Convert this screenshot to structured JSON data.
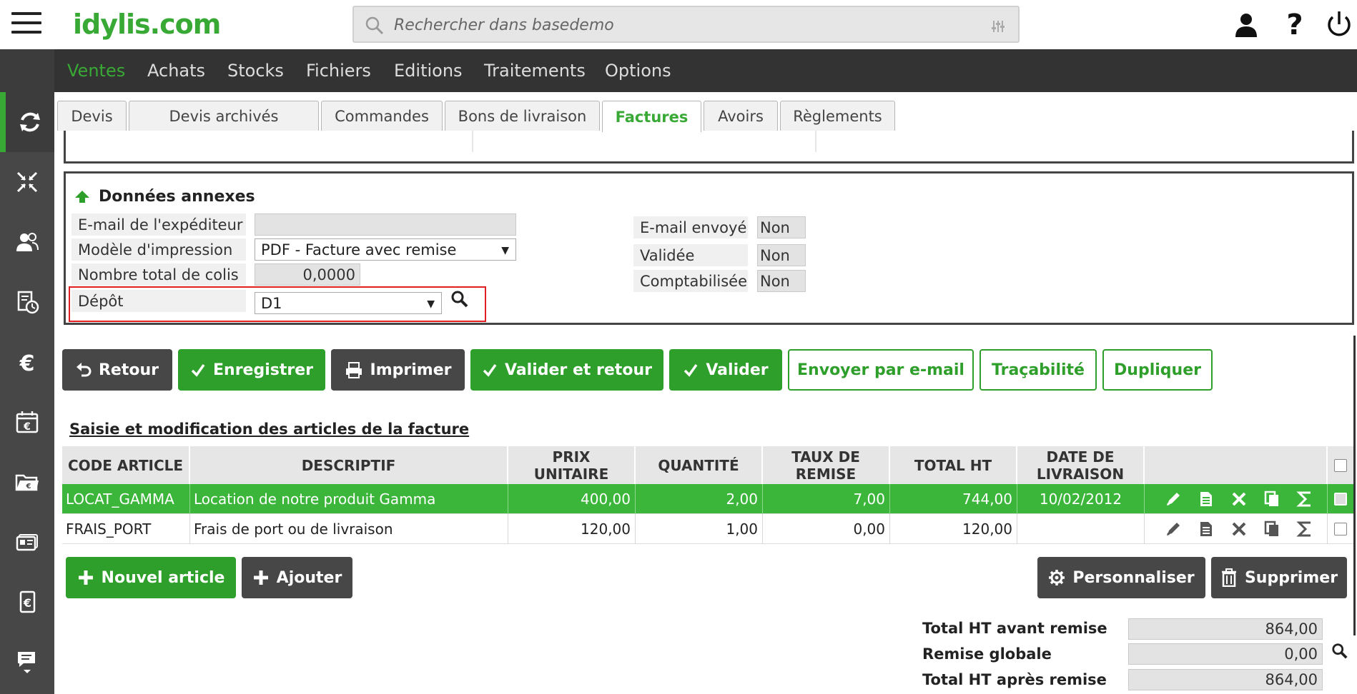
{
  "app": {
    "logo": "idylis.com"
  },
  "search": {
    "placeholder": "Rechercher dans basedemo"
  },
  "menu": [
    "Ventes",
    "Achats",
    "Stocks",
    "Fichiers",
    "Editions",
    "Traitements",
    "Options"
  ],
  "tabs": [
    "Devis",
    "Devis archivés",
    "Commandes",
    "Bons de livraison",
    "Factures",
    "Avoirs",
    "Règlements"
  ],
  "annex": {
    "title": "Données annexes",
    "email_expediteur_label": "E-mail de l'expéditeur",
    "email_expediteur_value": "",
    "modele_label": "Modèle d'impression",
    "modele_value": "PDF - Facture avec remise",
    "colis_label": "Nombre total de colis",
    "colis_value": "0,0000",
    "depot_label": "Dépôt",
    "depot_value": "D1",
    "email_envoye_label": "E-mail envoyé",
    "email_envoye_value": "Non",
    "validee_label": "Validée",
    "validee_value": "Non",
    "comptabilisee_label": "Comptabilisée",
    "comptabilisee_value": "Non"
  },
  "actions": {
    "retour": "Retour",
    "enregistrer": "Enregistrer",
    "imprimer": "Imprimer",
    "valider_retour": "Valider et retour",
    "valider": "Valider",
    "envoyer": "Envoyer par e-mail",
    "tracabilite": "Traçabilité",
    "dupliquer": "Dupliquer"
  },
  "section_title": "Saisie et modification des articles de la facture",
  "table": {
    "headers": {
      "code": "CODE ARTICLE",
      "descriptif": "DESCRIPTIF",
      "prix_1": "PRIX",
      "prix_2": "UNITAIRE",
      "quantite": "QUANTITÉ",
      "remise_1": "TAUX DE",
      "remise_2": "REMISE",
      "total": "TOTAL HT",
      "date_1": "DATE DE",
      "date_2": "LIVRAISON"
    },
    "rows": [
      {
        "code": "LOCAT_GAMMA",
        "descriptif": "Location de notre produit Gamma",
        "prix": "400,00",
        "quantite": "2,00",
        "remise": "7,00",
        "total": "744,00",
        "date": "10/02/2012"
      },
      {
        "code": "FRAIS_PORT",
        "descriptif": "Frais de port ou de livraison",
        "prix": "120,00",
        "quantite": "1,00",
        "remise": "0,00",
        "total": "120,00",
        "date": ""
      }
    ]
  },
  "bottom_buttons": {
    "nouvel_article": "Nouvel article",
    "ajouter": "Ajouter",
    "personnaliser": "Personnaliser",
    "supprimer": "Supprimer"
  },
  "totals": {
    "avant_label": "Total HT avant remise",
    "avant_value": "864,00",
    "remise_label": "Remise globale",
    "remise_value": "0,00",
    "apres_label": "Total HT après remise",
    "apres_value": "864,00"
  },
  "colors": {
    "brand_green": "#39a935",
    "dark": "#474747",
    "row_selected": "#3bb63a"
  }
}
